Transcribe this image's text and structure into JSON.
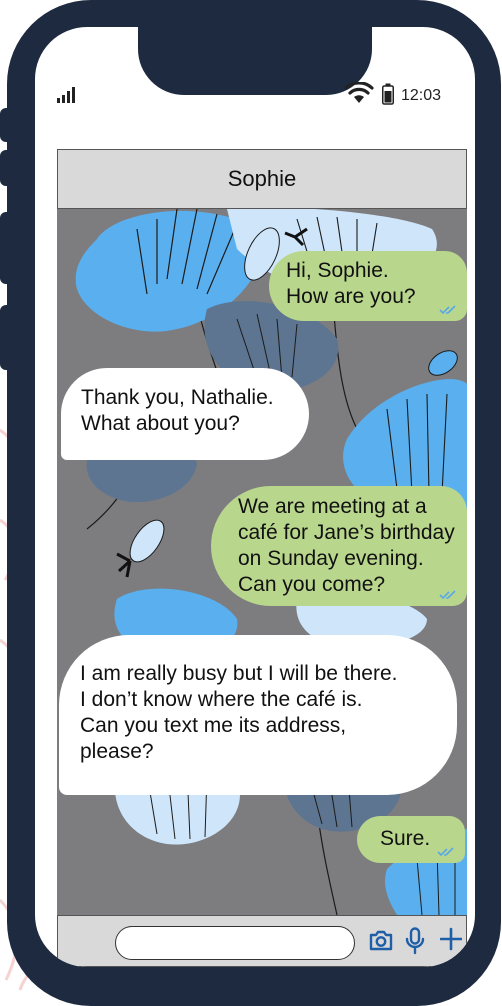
{
  "status_bar": {
    "time": "12:03",
    "icons": [
      "signal-icon",
      "wifi-icon",
      "battery-icon"
    ]
  },
  "contact": {
    "name": "Sophie"
  },
  "messages": [
    {
      "direction": "outgoing",
      "lines": [
        "Hi, Sophie.",
        "How are you?"
      ],
      "status": "read"
    },
    {
      "direction": "incoming",
      "lines": [
        "Thank you, Nathalie.",
        "What about you?"
      ]
    },
    {
      "direction": "outgoing",
      "lines": [
        "We are meeting at a",
        "café for Jane’s birthday",
        "on Sunday evening.",
        "Can you come?"
      ],
      "status": "read"
    },
    {
      "direction": "incoming",
      "lines": [
        "I am really busy but I will be there.",
        "I don’t know where the café is.",
        "Can you text me its address,",
        "please?"
      ]
    },
    {
      "direction": "outgoing",
      "lines": [
        "Sure."
      ],
      "status": "read"
    }
  ],
  "composer": {
    "placeholder": "",
    "icons": [
      "camera-icon",
      "microphone-icon",
      "plus-icon"
    ]
  },
  "colors": {
    "phone_frame": "#1e2a3f",
    "outgoing_bubble": "#b9d68d",
    "incoming_bubble": "#ffffff",
    "chat_background": "#7d7d80",
    "read_ticks": "#5aa9e6",
    "icon_blue": "#1f5fa8"
  }
}
